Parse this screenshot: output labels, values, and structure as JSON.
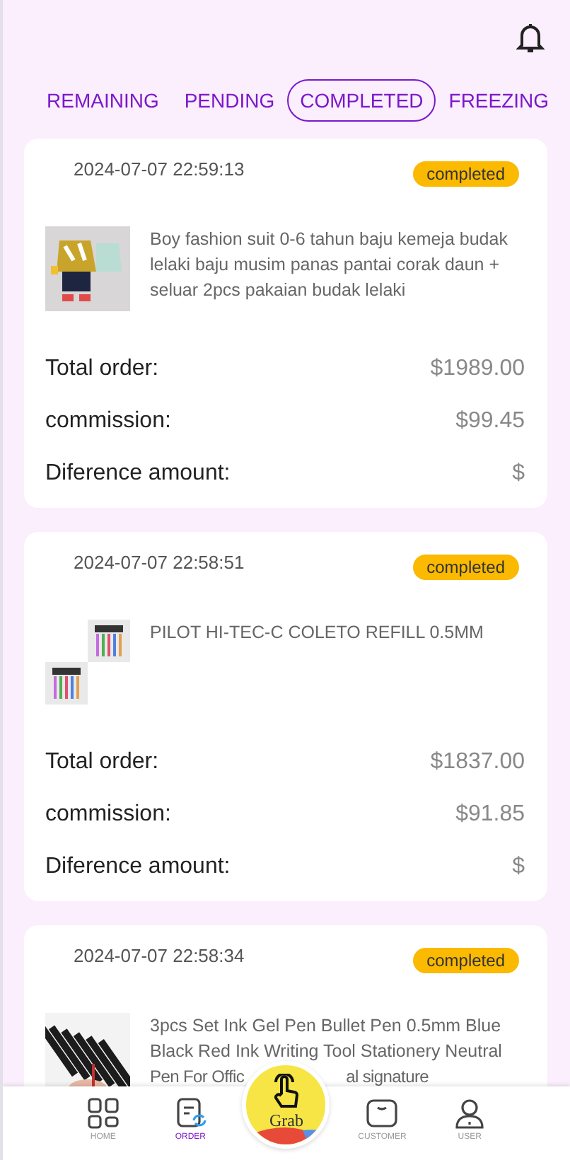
{
  "tabs": [
    {
      "label": "REMAINING",
      "selected": false
    },
    {
      "label": "PENDING",
      "selected": false
    },
    {
      "label": "COMPLETED",
      "selected": true
    },
    {
      "label": "FREEZING",
      "selected": false
    }
  ],
  "orders": [
    {
      "date": "2024-07-07 22:59:13",
      "status": "completed",
      "thumbnail": {
        "kind": "single"
      },
      "description": [
        "Boy fashion suit 0-6 tahun baju kemeja budak lelaki baju musim panas pantai corak daun + seluar 2pcs pakaian budak lelaki"
      ],
      "rows": [
        {
          "label": "Total order:",
          "value": "$1989.00"
        },
        {
          "label": "commission:",
          "value": "$99.45"
        },
        {
          "label": "Diference amount:",
          "value": "$"
        }
      ]
    },
    {
      "date": "2024-07-07 22:58:51",
      "status": "completed",
      "thumbnail": {
        "kind": "pair"
      },
      "description": [
        "PILOT HI-TEC-C COLETO REFILL 0.5MM"
      ],
      "rows": [
        {
          "label": "Total order:",
          "value": "$1837.00"
        },
        {
          "label": "commission:",
          "value": "$91.85"
        },
        {
          "label": "Diference amount:",
          "value": "$"
        }
      ]
    },
    {
      "date": "2024-07-07 22:58:34",
      "status": "completed",
      "thumbnail": {
        "kind": "single"
      },
      "description": [
        "3pcs Set Ink Gel Pen Bullet Pen 0.5mm Blue Black Red Ink Writing Tool Stationery Neutral",
        "Pen For Offic",
        "al signature"
      ]
    }
  ],
  "nav": [
    {
      "kind": "home",
      "label": "HOME",
      "selected": false
    },
    {
      "kind": "order",
      "label": "ORDER",
      "selected": true
    },
    {
      "kind": "grab",
      "label": "Grab",
      "selected": false
    },
    {
      "kind": "customer",
      "label": "CUSTOMER",
      "selected": false
    },
    {
      "kind": "user",
      "label": "USER",
      "selected": false
    }
  ]
}
